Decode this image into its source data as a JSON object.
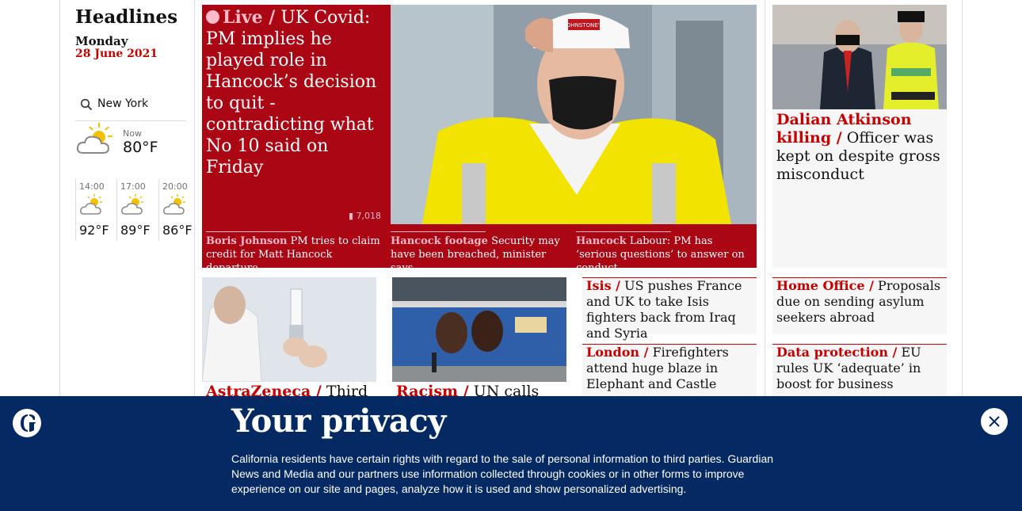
{
  "sidebar": {
    "title": "Headlines",
    "day": "Monday",
    "date": "28 June 2021",
    "location": "New York",
    "now_label": "Now",
    "now_temp": "80°F",
    "forecast": [
      {
        "time": "14:00",
        "temp": "92°F"
      },
      {
        "time": "17:00",
        "temp": "89°F"
      },
      {
        "time": "20:00",
        "temp": "86°F"
      }
    ]
  },
  "main": {
    "live_kicker": "Live /",
    "live_headline": "UK Covid: PM implies he played role in Hancock’s decision to quit - contradicting what No 10 said on Friday",
    "comments": "7,018",
    "subs": [
      {
        "kicker": "Boris Johnson",
        "text": "PM tries to claim credit for Matt Hancock departure"
      },
      {
        "kicker": "Hancock footage",
        "text": "Security may have been breached, minister says"
      },
      {
        "kicker": "Hancock",
        "text": "Labour: PM has ‘serious questions’ to answer on conduct"
      }
    ],
    "hero_badge": "JOHNSTONE'S"
  },
  "right": {
    "kicker": "Dalian Atkinson killing /",
    "headline": "Officer was kept on despite gross misconduct"
  },
  "lower": {
    "astra": {
      "kicker": "AstraZeneca /",
      "headline": "Third"
    },
    "racism": {
      "kicker": "Racism /",
      "headline": "UN calls for"
    },
    "isis": {
      "kicker": "Isis /",
      "headline": "US pushes France and UK to take Isis fighters back from Iraq and Syria"
    },
    "london": {
      "kicker": "London /",
      "headline": "Firefighters attend huge blaze in Elephant and Castle"
    },
    "home_office": {
      "kicker": "Home Office /",
      "headline": "Proposals due on sending asylum seekers abroad"
    },
    "data_protection": {
      "kicker": "Data protection /",
      "headline": "EU rules UK ‘adequate’ in boost for business"
    }
  },
  "banner": {
    "title": "Your privacy",
    "body": "California residents have certain rights with regard to the sale of personal information to third parties. Guardian News and Media and our partners use information collected through cookies or in other forms to improve experience on our site and pages, analyze how it is used and show personalized advertising."
  },
  "colors": {
    "guardian_red": "#c70000",
    "live_red": "#ab0613",
    "banner_blue": "#052962",
    "pink": "#ffbac8"
  }
}
